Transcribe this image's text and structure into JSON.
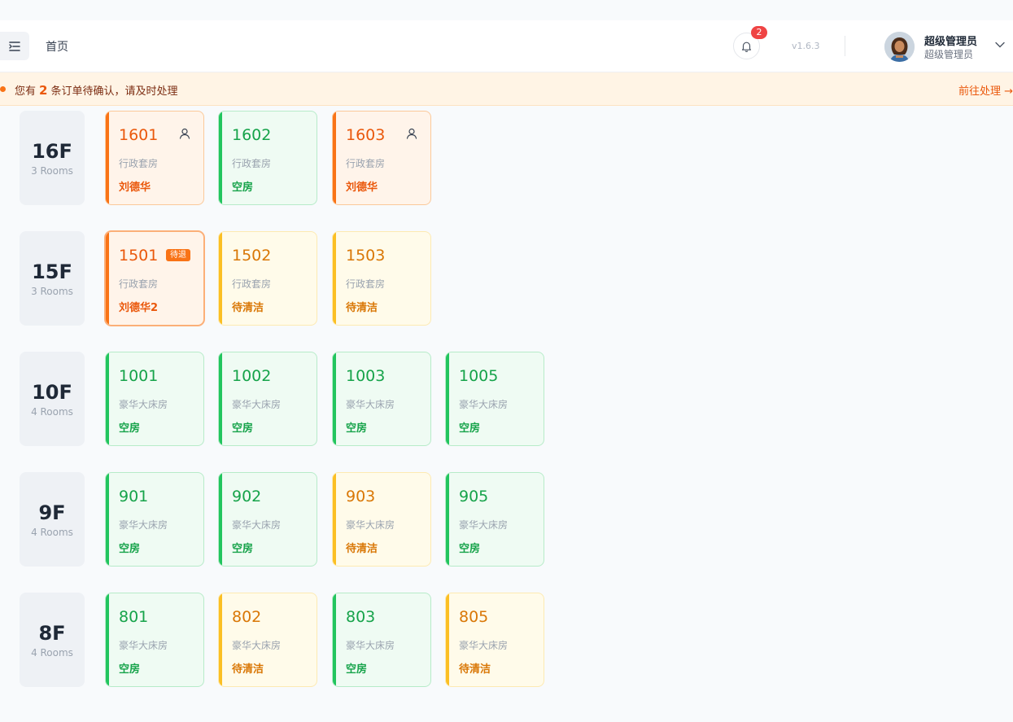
{
  "header": {
    "breadcrumb": "首页",
    "notification_count": "2",
    "version": "v1.6.3",
    "user_name": "超级管理员",
    "user_role": "超级管理员"
  },
  "notice": {
    "prefix": "您有",
    "count": "2",
    "suffix": "条订单待确认，请及时处理",
    "action": "前往处理 →"
  },
  "floors": [
    {
      "label": "16F",
      "count": "3 Rooms",
      "rooms": [
        {
          "num": "1601",
          "type": "行政套房",
          "status": "刘德华",
          "color": "orange",
          "icon": "person-icon"
        },
        {
          "num": "1602",
          "type": "行政套房",
          "status": "空房",
          "color": "green"
        },
        {
          "num": "1603",
          "type": "行政套房",
          "status": "刘德华",
          "color": "orange",
          "icon": "person-icon"
        }
      ]
    },
    {
      "label": "15F",
      "count": "3 Rooms",
      "rooms": [
        {
          "num": "1501",
          "type": "行政套房",
          "status": "刘德华2",
          "color": "orange",
          "tag": "待退"
        },
        {
          "num": "1502",
          "type": "行政套房",
          "status": "待清洁",
          "color": "yellow"
        },
        {
          "num": "1503",
          "type": "行政套房",
          "status": "待清洁",
          "color": "yellow"
        }
      ]
    },
    {
      "label": "10F",
      "count": "4 Rooms",
      "rooms": [
        {
          "num": "1001",
          "type": "豪华大床房",
          "status": "空房",
          "color": "green"
        },
        {
          "num": "1002",
          "type": "豪华大床房",
          "status": "空房",
          "color": "green"
        },
        {
          "num": "1003",
          "type": "豪华大床房",
          "status": "空房",
          "color": "green"
        },
        {
          "num": "1005",
          "type": "豪华大床房",
          "status": "空房",
          "color": "green"
        }
      ]
    },
    {
      "label": "9F",
      "count": "4 Rooms",
      "rooms": [
        {
          "num": "901",
          "type": "豪华大床房",
          "status": "空房",
          "color": "green"
        },
        {
          "num": "902",
          "type": "豪华大床房",
          "status": "空房",
          "color": "green"
        },
        {
          "num": "903",
          "type": "豪华大床房",
          "status": "待清洁",
          "color": "yellow"
        },
        {
          "num": "905",
          "type": "豪华大床房",
          "status": "空房",
          "color": "green"
        }
      ]
    },
    {
      "label": "8F",
      "count": "4 Rooms",
      "rooms": [
        {
          "num": "801",
          "type": "豪华大床房",
          "status": "空房",
          "color": "green"
        },
        {
          "num": "802",
          "type": "豪华大床房",
          "status": "待清洁",
          "color": "yellow"
        },
        {
          "num": "803",
          "type": "豪华大床房",
          "status": "空房",
          "color": "green"
        },
        {
          "num": "805",
          "type": "豪华大床房",
          "status": "待清洁",
          "color": "yellow"
        }
      ]
    }
  ],
  "colors": {
    "green": "#16a34a",
    "orange": "#ea580c",
    "yellow": "#d97706",
    "badge": "#ef4444"
  }
}
